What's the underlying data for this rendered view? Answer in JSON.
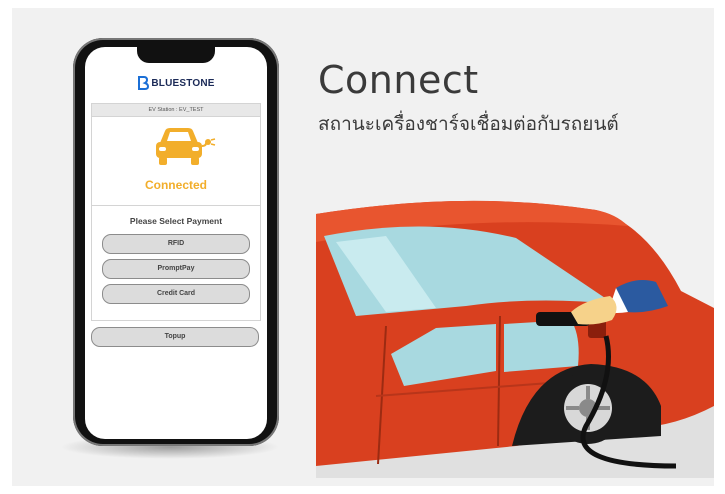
{
  "brand": {
    "name": "BLUESTONE"
  },
  "app": {
    "station_label": "EV Station : EV_TEST",
    "connection_status": "Connected",
    "payment_prompt": "Please Select Payment",
    "payment_options": [
      "RFID",
      "PromptPay",
      "Credit Card"
    ],
    "topup_label": "Topup"
  },
  "headline": {
    "title": "Connect",
    "subtitle": "สถานะเครื่องชาร์จเชื่อมต่อกับรถยนต์"
  },
  "colors": {
    "status": "#f2ae2b",
    "car_body": "#d9401f",
    "glass": "#a8d9e0",
    "brand": "#1b2a57"
  },
  "icons": [
    "bluestone-logo-icon",
    "car-plug-icon"
  ]
}
